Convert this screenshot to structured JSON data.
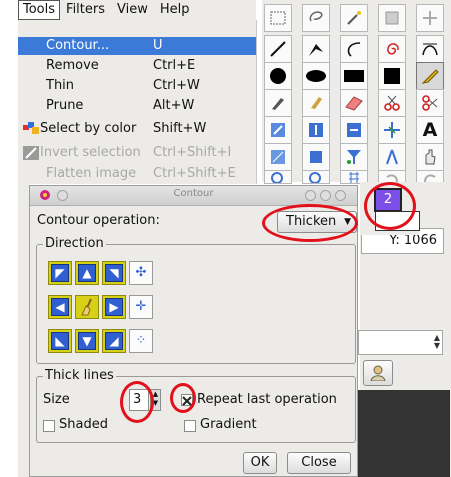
{
  "menubar": {
    "items": [
      "Tools",
      "Filters",
      "View",
      "Help"
    ]
  },
  "menu": {
    "items": [
      {
        "label": "Contour...",
        "accel": "U",
        "state": "selected"
      },
      {
        "label": "Remove",
        "accel": "Ctrl+E",
        "state": "normal"
      },
      {
        "label": "Thin",
        "accel": "Ctrl+W",
        "state": "normal"
      },
      {
        "label": "Prune",
        "accel": "Alt+W",
        "state": "normal"
      },
      {
        "label": "Select by color",
        "accel": "Shift+W",
        "state": "normal"
      },
      {
        "label": "Invert selection",
        "accel": "Ctrl+Shift+I",
        "state": "disabled"
      },
      {
        "label": "Flatten image",
        "accel": "Ctrl+Shift+E",
        "state": "disabled"
      }
    ]
  },
  "status": {
    "y_label": "Y: 1066"
  },
  "palette": {
    "badge": "2"
  },
  "dialog": {
    "title": "Contour",
    "operation_label": "Contour operation:",
    "operation_value": "Thicken",
    "direction_legend": "Direction",
    "thick_lines_legend": "Thick lines",
    "size_label": "Size",
    "size_value": "3",
    "repeat_label": "Repeat last operation",
    "shaded_label": "Shaded",
    "gradient_label": "Gradient",
    "ok_label": "OK",
    "close_label": "Close"
  },
  "colors": {
    "menu_highlight": "#3b7ad6",
    "annotation_red": "#e2101a",
    "direction_button_yellow": "#d7d116",
    "direction_arrow_blue": "#2f5fd0",
    "badge_purple": "#7b4fe8"
  }
}
